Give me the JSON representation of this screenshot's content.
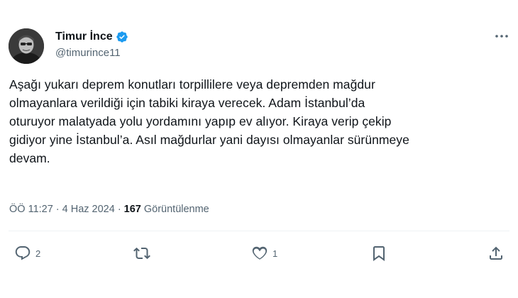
{
  "author": {
    "display_name": "Timur İnce",
    "handle": "@timurince11",
    "verified": true
  },
  "tweet": {
    "text": "Aşağı yukarı deprem konutları torpillilere veya depremden mağdur\nolmayanlara verildiği için tabiki kiraya verecek. Adam İstanbul’da\noturuyor malatyada yolu yordamını yapıp ev alıyor. Kiraya verip çekip\ngidiyor yine İstanbul’a. Asıl mağdurlar yani dayısı olmayanlar sürünmeye\ndevam."
  },
  "meta": {
    "time": "ÖÖ 11:27",
    "separator": "·",
    "date": "4 Haz 2024",
    "views_count": "167",
    "views_label": "Görüntülenme"
  },
  "actions": {
    "reply_count": "2",
    "retweet_count": "",
    "like_count": "1"
  },
  "icons": {
    "verified": "verified-badge-icon",
    "more": "more-dots-icon",
    "reply": "reply-icon",
    "retweet": "retweet-icon",
    "like": "heart-icon",
    "bookmark": "bookmark-icon",
    "share": "share-icon"
  },
  "colors": {
    "text_primary": "#0f1419",
    "text_secondary": "#536471",
    "verified_blue": "#1d9bf0",
    "divider": "#eff3f4"
  }
}
